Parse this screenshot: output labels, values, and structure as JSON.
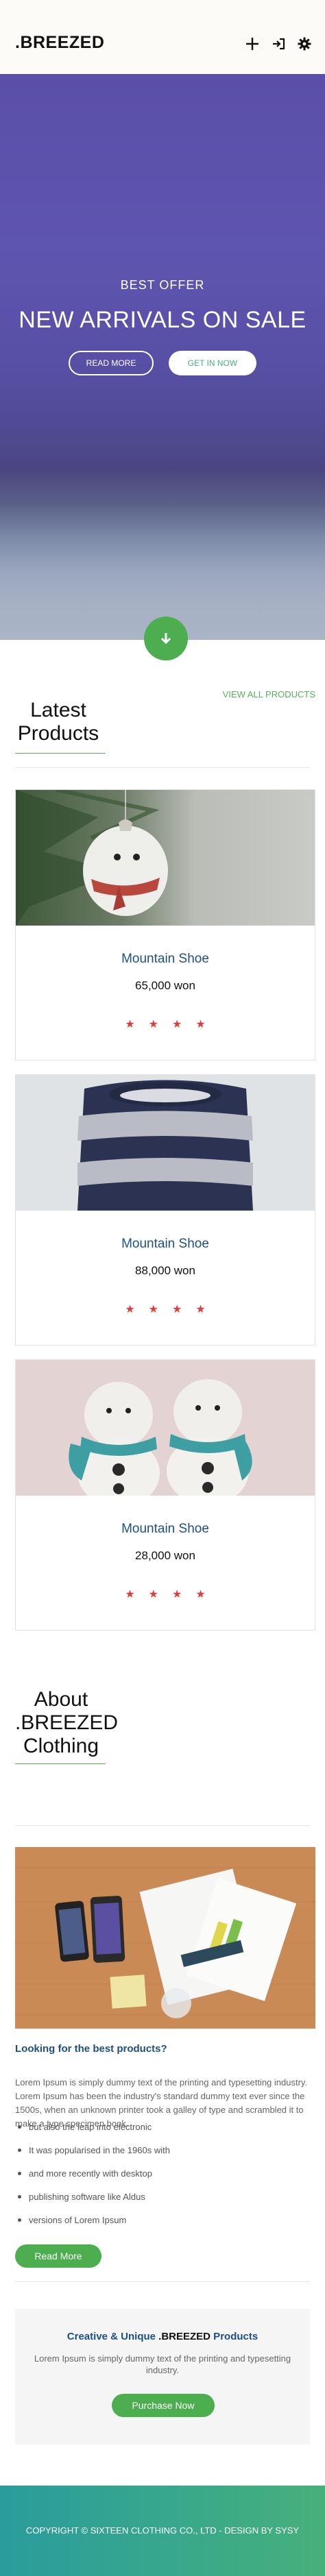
{
  "header": {
    "logo": ".BREEZED",
    "icons": [
      "plus-icon",
      "sign-in-icon",
      "gear-icon"
    ]
  },
  "hero": {
    "subtitle": "BEST OFFER",
    "title": "NEW ARRIVALS ON SALE",
    "read_more_label": "READ MORE",
    "get_in_now_label": "GET IN NOW"
  },
  "products": {
    "view_all_label": "VIEW ALL PRODUCTS",
    "title_line1": "Latest",
    "title_line2": "Products",
    "items": [
      {
        "name": "Mountain Shoe",
        "price": "65,000 won",
        "stars": 4
      },
      {
        "name": "Mountain Shoe",
        "price": "88,000 won",
        "stars": 4
      },
      {
        "name": "Mountain Shoe",
        "price": "28,000 won",
        "stars": 4
      }
    ]
  },
  "about": {
    "title_line1": "About",
    "title_line2": ".BREEZED",
    "title_line3": "Clothing",
    "heading": "Looking for the best products?",
    "paragraph": "Lorem Ipsum is simply dummy text of the printing and typesetting industry. Lorem Ipsum has been the industry's standard dummy text ever since the 1500s, when an unknown printer took a galley of type and scrambled it to make a type specimen book.",
    "bullets": [
      "but also the leap into electronic",
      "It was popularised in the 1960s with",
      "and more recently with desktop",
      "publishing software like Aldus",
      "versions of Lorem Ipsum"
    ],
    "read_more_label": "Read More"
  },
  "promo": {
    "title_prefix": "Creative & Unique ",
    "title_brand": ".BREEZED",
    "title_suffix": " Products",
    "text": "Lorem Ipsum is simply dummy text of the printing and typesetting industry.",
    "button_label": "Purchase Now"
  },
  "footer": {
    "text": "COPYRIGHT © SIXTEEN CLOTHING CO., LTD - DESIGN BY SYSY"
  },
  "colors": {
    "accent_green": "#4cae4f",
    "title_blue": "#1e4e86",
    "star_red": "#e53b3b",
    "hero_purple": "#5a4ea8"
  }
}
